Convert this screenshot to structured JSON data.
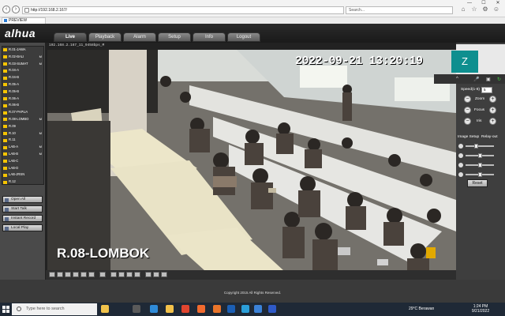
{
  "browser": {
    "address": "http://192.168.2.167/",
    "search_placeholder": "Search...",
    "tab_title": "PREVIEW",
    "win_min": "—",
    "win_max": "☐",
    "win_close": "✕"
  },
  "app": {
    "logo": "alhua",
    "tabs": [
      "Live",
      "Playback",
      "Alarm",
      "Setup",
      "Info",
      "Logout"
    ]
  },
  "channels": [
    {
      "label": "R.01-JAWA",
      "mark": ""
    },
    {
      "label": "R.02-BALI",
      "mark": "M"
    },
    {
      "label": "R.03-SUMAT",
      "mark": "M"
    },
    {
      "label": "R.04-A",
      "mark": ""
    },
    {
      "label": "R.04-B",
      "mark": ""
    },
    {
      "label": "R.05-A",
      "mark": ""
    },
    {
      "label": "R.05-B",
      "mark": ""
    },
    {
      "label": "R.06-A",
      "mark": ""
    },
    {
      "label": "R.06-B",
      "mark": ""
    },
    {
      "label": "R.07-PAPUA",
      "mark": ""
    },
    {
      "label": "R.08-LOMBO",
      "mark": "M"
    },
    {
      "label": "R.09",
      "mark": ""
    },
    {
      "label": "R.10",
      "mark": "M"
    },
    {
      "label": "R.11",
      "mark": ""
    },
    {
      "label": "LAB-A",
      "mark": "M"
    },
    {
      "label": "LAB-B",
      "mark": "M"
    },
    {
      "label": "LAB-C",
      "mark": ""
    },
    {
      "label": "LAB-D",
      "mark": ""
    },
    {
      "label": "LAB-JRSN",
      "mark": ""
    },
    {
      "label": "R.12",
      "mark": ""
    }
  ],
  "left_buttons": [
    "Open All",
    "Start Talk",
    "Instant Record",
    "Local Play"
  ],
  "video": {
    "cam_info": "192.168.2.167_11_9458bps_M",
    "timestamp": "2022-09-21 13:20:19",
    "channel_name": "R.08-LOMBOK"
  },
  "ptz": {
    "avatar_letter": "Z",
    "speed_label": "Speed(1-8)",
    "speed_value": "5",
    "zoom_label": "Zoom",
    "focus_label": "Focus",
    "iris_label": "Iris",
    "image_setup_label": "Image Setup",
    "relay_out_label": "Relay-out",
    "reset_label": "Reset",
    "slider_levels": [
      0.35,
      0.5,
      0.5,
      0.5
    ]
  },
  "footer": {
    "copyright": "Copyright 2015 All Rights Reserved."
  },
  "taskbar": {
    "search_placeholder": "Type here to search",
    "weather": "29°C  Berawan",
    "time": "1:24 PM",
    "date": "9/21/2022"
  }
}
